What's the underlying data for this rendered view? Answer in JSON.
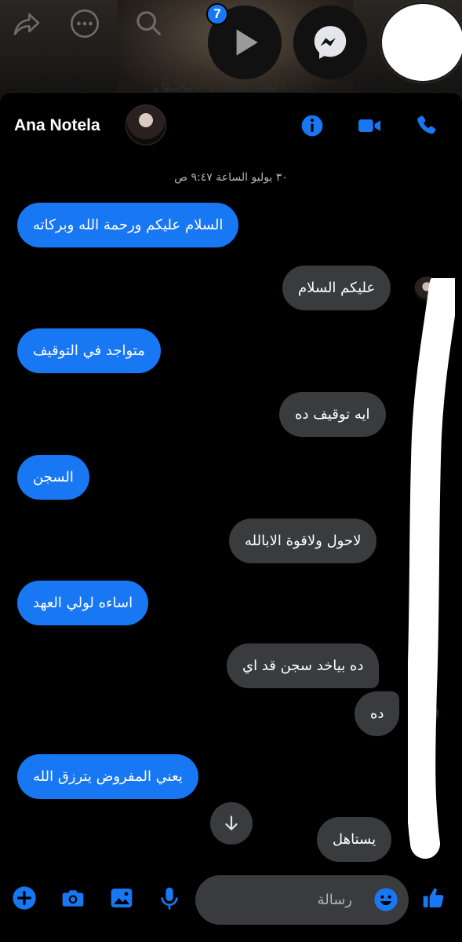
{
  "background": {
    "title_text": "أساطين الحق",
    "play_badge_count": "7"
  },
  "header": {
    "contact_name": "Ana Notela"
  },
  "conversation": {
    "timestamp": "٣٠ يوليو الساعة ٩:٤٧ ص",
    "messages": [
      {
        "from": "me",
        "text": "السلام عليكم ورحمة الله وبركاته"
      },
      {
        "from": "them",
        "text": "عليكم السلام"
      },
      {
        "from": "me",
        "text": "متواجد في التوقيف"
      },
      {
        "from": "them",
        "text": "ايه توقيف ده"
      },
      {
        "from": "me",
        "text": "السجن"
      },
      {
        "from": "them",
        "text": "لاحول ولاقوة الابالله"
      },
      {
        "from": "me",
        "text": "اساءه لولي العهد"
      },
      {
        "from": "them",
        "text": "ده بياخد سجن قد اي"
      },
      {
        "from": "them",
        "text": "ده"
      },
      {
        "from": "me",
        "text": "يعني المفروض يترزق الله"
      },
      {
        "from": "them",
        "text": "يستاهل"
      }
    ]
  },
  "composer": {
    "placeholder": "رسالة"
  },
  "colors": {
    "accent": "#1877f2",
    "sent_bubble": "#1877f2",
    "received_bubble": "#3a3b3c",
    "background": "#000000"
  },
  "icons": [
    "share-icon",
    "more-icon",
    "search-icon",
    "play-icon",
    "messenger-icon",
    "info-icon",
    "video-call-icon",
    "phone-icon",
    "arrow-down-icon",
    "plus-icon",
    "camera-icon",
    "gallery-icon",
    "microphone-icon",
    "emoji-icon",
    "like-icon"
  ]
}
